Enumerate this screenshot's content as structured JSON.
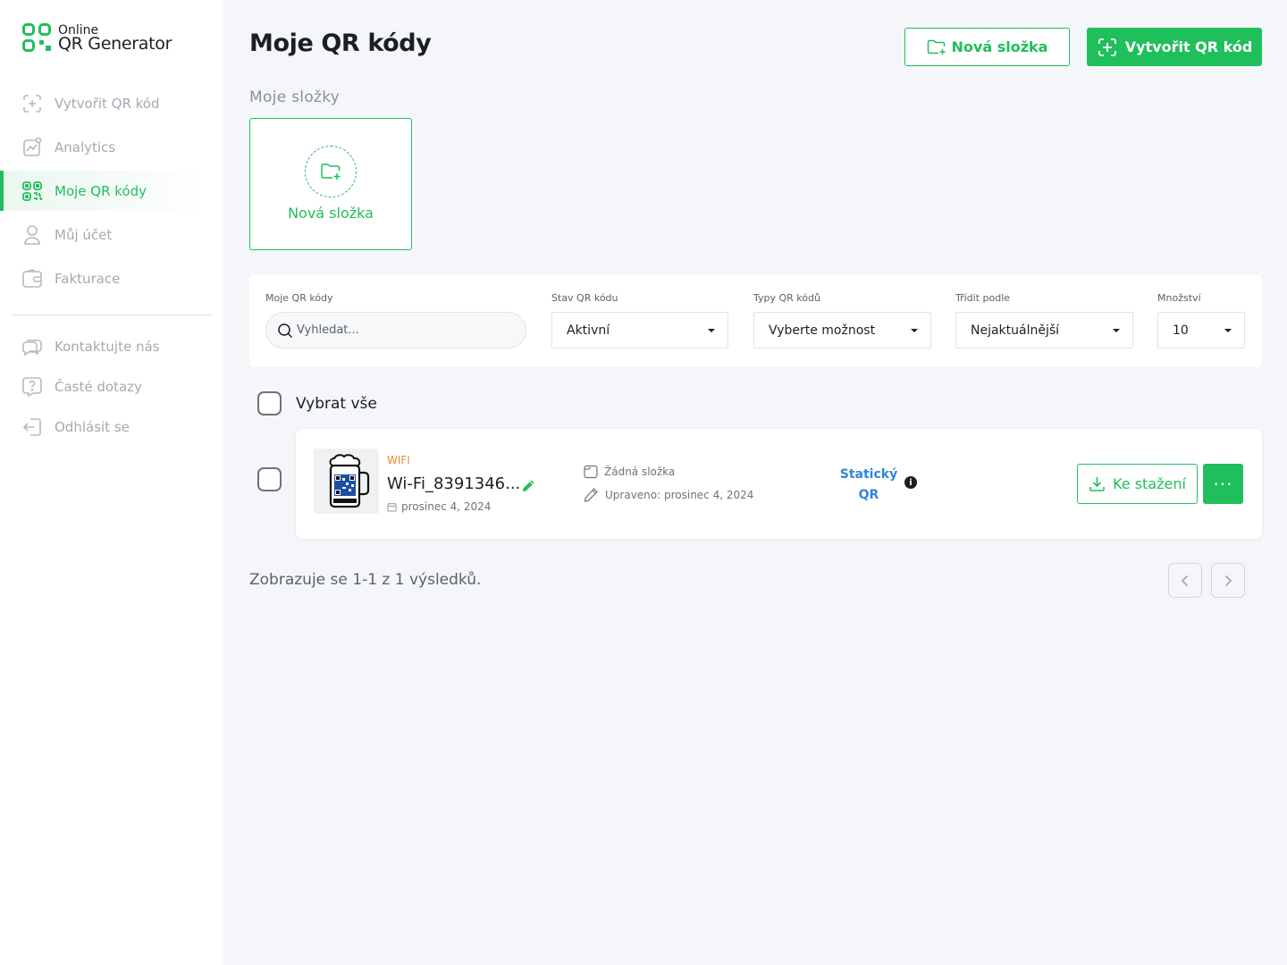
{
  "logo": {
    "line1": "Online",
    "line2": "QR Generator"
  },
  "nav": [
    {
      "label": "Vytvořit QR kód",
      "icon": "qr-plus-icon"
    },
    {
      "label": "Analytics",
      "icon": "chart-icon"
    },
    {
      "label": "Moje QR kódy",
      "icon": "qr-codes-icon",
      "active": true
    },
    {
      "label": "Můj účet",
      "icon": "user-icon"
    },
    {
      "label": "Fakturace",
      "icon": "wallet-icon"
    }
  ],
  "nav_secondary": [
    {
      "label": "Kontaktujte nás",
      "icon": "chat-icon"
    },
    {
      "label": "Časté dotazy",
      "icon": "question-icon"
    },
    {
      "label": "Odhlásit se",
      "icon": "logout-icon"
    }
  ],
  "header": {
    "title": "Moje QR kódy",
    "new_folder_label": "Nová složka",
    "create_label": "Vytvořit QR kód"
  },
  "folders": {
    "section_label": "Moje složky",
    "new_folder_label": "Nová složka"
  },
  "filters": {
    "search_label": "Moje QR kódy",
    "search_placeholder": "Vyhledat...",
    "status_label": "Stav QR kódu",
    "status_value": "Aktivní",
    "types_label": "Typy QR kódů",
    "types_value": "Vyberte možnost",
    "sort_label": "Třídit podle",
    "sort_value": "Nejaktuálnější",
    "quantity_label": "Množství",
    "quantity_value": "10"
  },
  "select_all_label": "Vybrat vše",
  "qr_codes": [
    {
      "type": "WIFI",
      "name": "Wi-Fi_8391346...",
      "created": "prosinec 4, 2024",
      "folder": "Žádná složka",
      "modified": "Upraveno: prosinec 4, 2024",
      "kind_line1": "Statický",
      "kind_line2": "QR",
      "download_label": "Ke stažení",
      "more_label": "···"
    }
  ],
  "pagination": {
    "results_text": "Zobrazuje se 1-1 z 1 výsledků."
  },
  "colors": {
    "accent": "#1fbf5b",
    "type_label": "#f08c2e",
    "static_label": "#2f86d6",
    "background": "#f4f6f9"
  }
}
